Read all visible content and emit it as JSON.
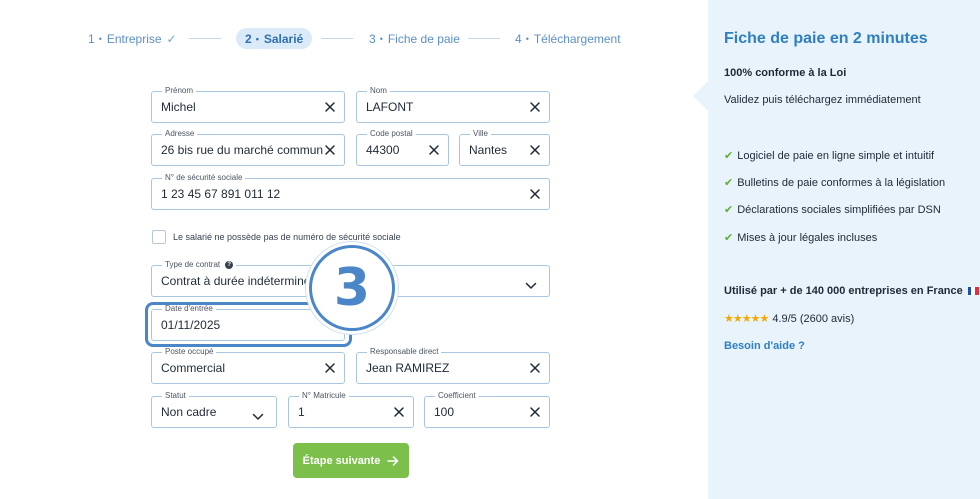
{
  "stepper": {
    "steps": [
      {
        "num": "1",
        "label": "Entreprise",
        "done": true
      },
      {
        "num": "2",
        "label": "Salarié",
        "active": true
      },
      {
        "num": "3",
        "label": "Fiche de paie"
      },
      {
        "num": "4",
        "label": "Téléchargement"
      }
    ],
    "separator": "•"
  },
  "form": {
    "prenom": {
      "label": "Prénom",
      "value": "Michel"
    },
    "nom": {
      "label": "Nom",
      "value": "LAFONT"
    },
    "adresse": {
      "label": "Adresse",
      "value": "26 bis rue du marché commun"
    },
    "code_postal": {
      "label": "Code postal",
      "value": "44300"
    },
    "ville": {
      "label": "Ville",
      "value": "Nantes"
    },
    "secu": {
      "label": "N° de sécurité sociale",
      "value": "1 23 45 67 891 011 12"
    },
    "no_secu_checkbox": {
      "label": "Le salarié ne possède pas de numéro de sécurité sociale",
      "checked": false
    },
    "type_contrat": {
      "label": "Type de contrat",
      "value": "Contrat à durée indéterminée (",
      "help_icon": "question-circle-icon"
    },
    "date_entree": {
      "label": "Date d'entrée",
      "value": "01/11/2025"
    },
    "poste": {
      "label": "Poste occupé",
      "value": "Commercial"
    },
    "responsable": {
      "label": "Responsable direct",
      "value": "Jean RAMIREZ"
    },
    "statut": {
      "label": "Statut",
      "value": "Non cadre"
    },
    "matricule": {
      "label": "N° Matricule",
      "value": "1"
    },
    "coefficient": {
      "label": "Coefficient",
      "value": "100"
    }
  },
  "overlay": {
    "step_number": "3",
    "color": "#4a86c8"
  },
  "next_button": {
    "label": "Étape suivante",
    "color": "#7cc04b"
  },
  "panel": {
    "title": "Fiche de paie en 2 minutes",
    "subtitle": "100% conforme à la Loi",
    "text": "Validez puis téléchargez immédiatement",
    "features": [
      "Logiciel de paie en ligne simple et intuitif",
      "Bulletins de paie conformes à la législation",
      "Déclarations sociales simplifiées par DSN",
      "Mises à jour légales incluses"
    ],
    "stat": "Utilisé par + de 140 000 entreprises en France",
    "stars": "★★★★★",
    "rating": "4.9/5 (2600 avis)",
    "help": "Besoin d'aide ?",
    "accent": "#2f7fc1"
  }
}
